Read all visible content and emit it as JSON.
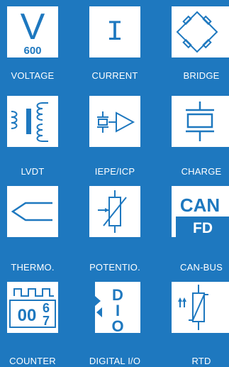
{
  "colors": {
    "background": "#1e78bf",
    "tile": "#ffffff",
    "accent": "#1e78bf"
  },
  "tiles": [
    {
      "label": "VOLTAGE",
      "icon": "voltage-icon",
      "glyph": "V",
      "sub": "600"
    },
    {
      "label": "CURRENT",
      "icon": "current-icon",
      "glyph": "I"
    },
    {
      "label": "BRIDGE",
      "icon": "bridge-icon"
    },
    {
      "label": "LVDT",
      "icon": "lvdt-icon"
    },
    {
      "label": "IEPE/ICP",
      "icon": "iepe-icp-icon"
    },
    {
      "label": "CHARGE",
      "icon": "charge-icon"
    },
    {
      "label": "THERMO.",
      "icon": "thermocouple-icon"
    },
    {
      "label": "POTENTIO.",
      "icon": "potentiometer-icon"
    },
    {
      "label": "CAN-BUS",
      "icon": "can-bus-icon",
      "top": "CAN",
      "bottom": "FD"
    },
    {
      "label": "COUNTER",
      "icon": "counter-icon",
      "digits": "00",
      "top_digit": "6",
      "bottom_digit": "7"
    },
    {
      "label": "DIGITAL I/O",
      "icon": "digital-io-icon",
      "letters": [
        "D",
        "I",
        "O"
      ]
    },
    {
      "label": "RTD",
      "icon": "rtd-icon"
    }
  ]
}
